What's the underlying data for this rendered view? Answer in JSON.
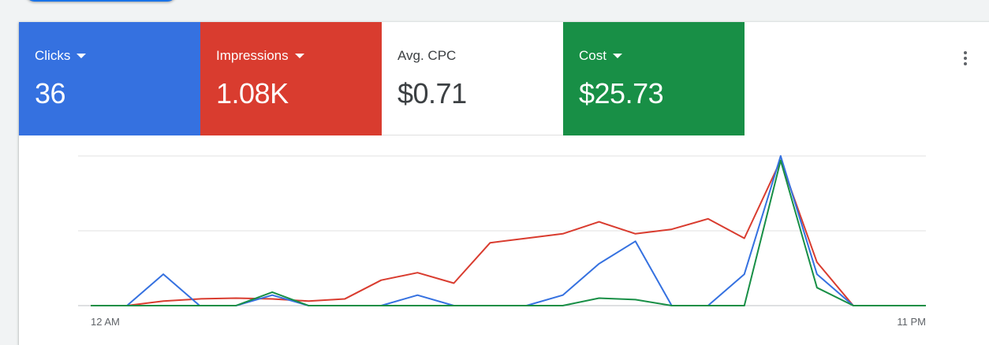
{
  "metrics": [
    {
      "label": "Clicks",
      "value": "36",
      "has_dropdown": true,
      "color": "#3571e0"
    },
    {
      "label": "Impressions",
      "value": "1.08K",
      "has_dropdown": true,
      "color": "#d93c2f"
    },
    {
      "label": "Avg. CPC",
      "value": "$0.71",
      "has_dropdown": false,
      "color": "#ffffff"
    },
    {
      "label": "Cost",
      "value": "$25.73",
      "has_dropdown": true,
      "color": "#188f46"
    }
  ],
  "menu": {
    "icon": "more-vert-icon"
  },
  "chart_data": {
    "type": "line",
    "xlabel": "",
    "ylabel": "",
    "x_tick_labels": [
      "12 AM",
      "11 PM"
    ],
    "x": [
      0,
      1,
      2,
      3,
      4,
      5,
      6,
      7,
      8,
      9,
      10,
      11,
      12,
      13,
      14,
      15,
      16,
      17,
      18,
      19,
      20,
      21,
      22,
      23
    ],
    "ylim": [
      0,
      1
    ],
    "y_ticks": [
      0,
      0.5,
      1
    ],
    "grid": true,
    "legend": false,
    "series": [
      {
        "color": "#3571e0",
        "values": [
          0,
          0,
          0.21,
          0,
          0,
          0.07,
          0,
          0,
          0,
          0.07,
          0,
          0,
          0,
          0.07,
          0.28,
          0.43,
          0,
          0,
          0.21,
          1.0,
          0.21,
          0,
          0,
          0
        ]
      },
      {
        "color": "#d93c2f",
        "values": [
          0,
          0,
          0.03,
          0.045,
          0.05,
          0.045,
          0.03,
          0.045,
          0.17,
          0.22,
          0.15,
          0.42,
          0.45,
          0.48,
          0.56,
          0.48,
          0.51,
          0.58,
          0.45,
          0.97,
          0.29,
          0,
          0,
          0
        ]
      },
      {
        "color": "#188f46",
        "values": [
          0,
          0,
          0,
          0,
          0,
          0.09,
          0,
          0,
          0,
          0,
          0,
          0,
          0,
          0,
          0.05,
          0.04,
          0,
          0,
          0,
          0.97,
          0.12,
          0,
          0,
          0
        ]
      }
    ]
  }
}
